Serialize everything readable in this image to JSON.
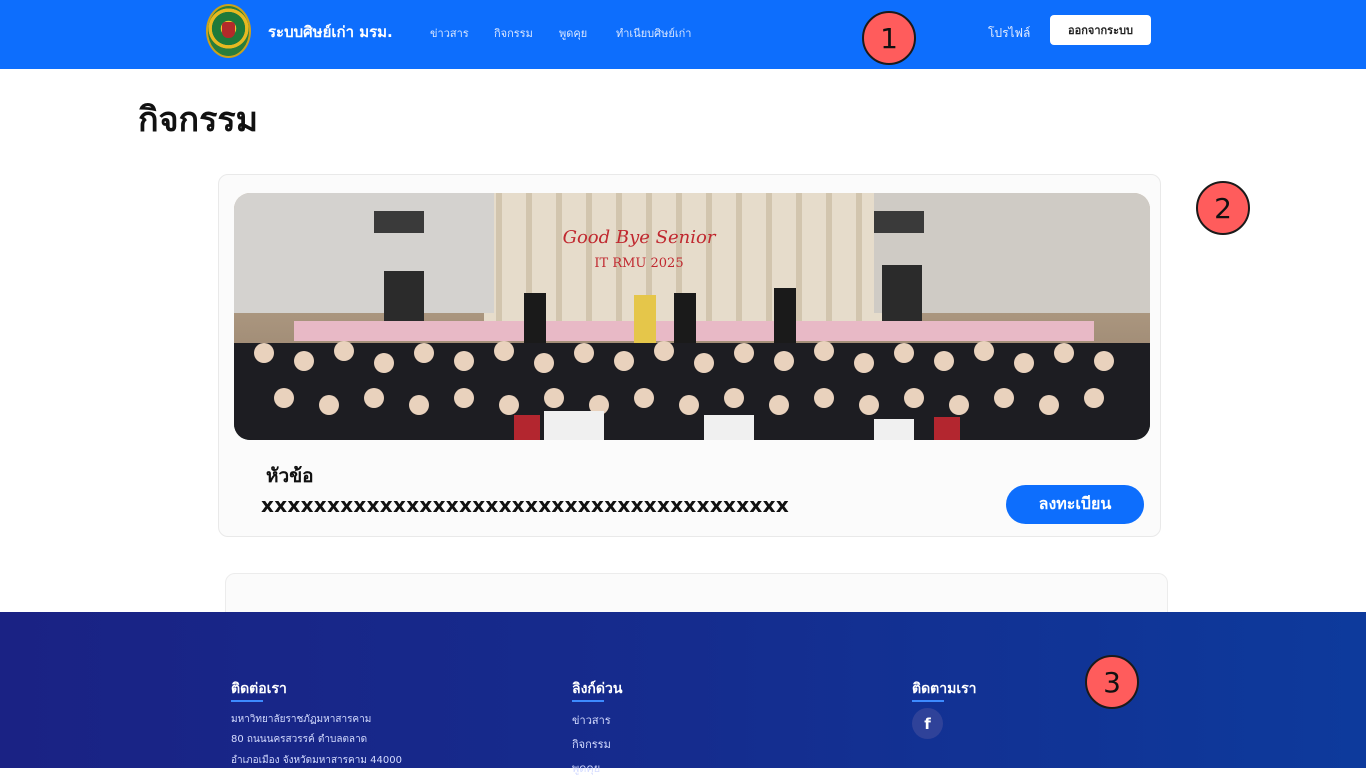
{
  "navbar": {
    "brand": "ระบบศิษย์เก่า มรม.",
    "links": [
      "ข่าวสาร",
      "กิจกรรม",
      "พูดคุย",
      "ทำเนียบศิษย์เก่า"
    ],
    "profile": "โปรไฟล์",
    "logout": "ออกจากระบบ"
  },
  "markers": [
    "1",
    "2",
    "3"
  ],
  "page": {
    "title": "กิจกรรม"
  },
  "activity_card": {
    "photo_banner_line1": "Good Bye Senior",
    "photo_banner_line2": "IT RMU 2025",
    "topic_label": "หัวข้อ",
    "description": "xxxxxxxxxxxxxxxxxxxxxxxxxxxxxxxxxxxxxxxx",
    "register": "ลงทะเบียน"
  },
  "footer": {
    "contact": {
      "heading": "ติดต่อเรา",
      "lines": [
        "มหาวิทยาลัยราชภัฏมหาสารคาม",
        "80 ถนนนครสวรรค์ ตำบลตลาด",
        "อำเภอเมือง จังหวัดมหาสารคาม 44000"
      ]
    },
    "quick_links": {
      "heading": "ลิงก์ด่วน",
      "links": [
        "ข่าวสาร",
        "กิจกรรม",
        "พูดคุย"
      ]
    },
    "follow": {
      "heading": "ติดตามเรา",
      "facebook_glyph": "f"
    }
  }
}
